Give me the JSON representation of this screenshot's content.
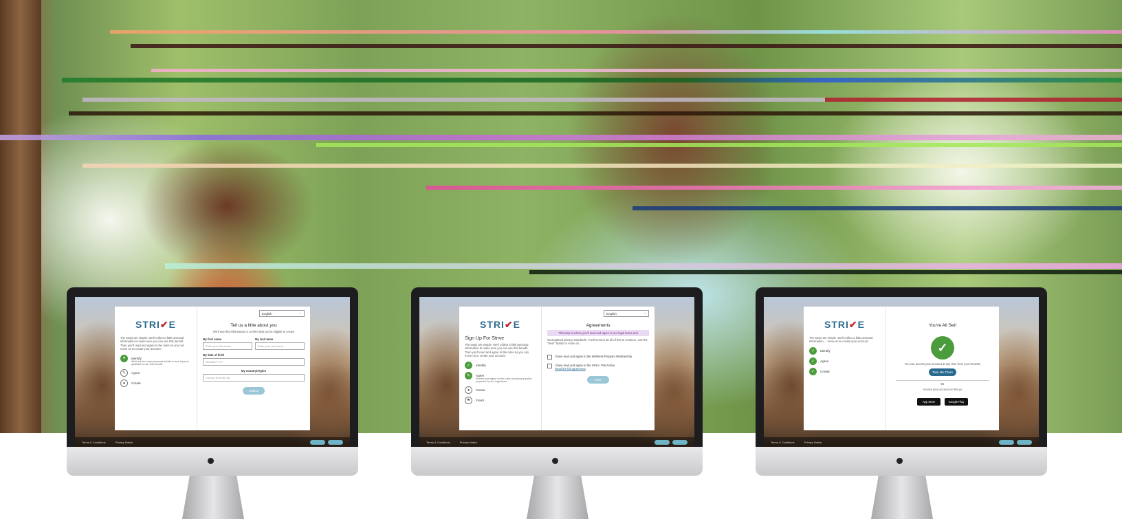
{
  "brand": {
    "logo_text_a": "STRI",
    "logo_tick": "✔",
    "logo_text_b": "E",
    "accent": "#2b6a8f",
    "check_green": "#4a9c3c"
  },
  "screens": [
    {
      "language": "English",
      "left": {
        "intro": "The steps are simple. We'll collect a little personal information to make sure you can use this benefit. Then you'll read and agree to the rules so you can move on to create your account.",
        "steps": [
          {
            "label": "Identify",
            "sub": "We'll ask for a few personal details to see if you're qualified to use this benefit."
          },
          {
            "label": "Agree",
            "sub": ""
          },
          {
            "label": "Create",
            "sub": ""
          }
        ]
      },
      "right": {
        "title": "Tell us a little about you",
        "text": "We'll use this information to confirm that you're eligible to create",
        "first_name_label": "My first name",
        "last_name_label": "My last name",
        "first_name_placeholder": "Enter your first name",
        "last_name_placeholder": "Enter your last name",
        "dob_label": "My date of birth",
        "dob_placeholder": "MM/DD/YYYY",
        "country_label": "My country/region",
        "country_placeholder": "Choose from the list",
        "submit": "Submit"
      },
      "footer": {
        "link1": "Terms & Conditions",
        "link2": "Privacy Notice"
      }
    },
    {
      "language": "English",
      "left": {
        "heading": "Sign Up For Strive",
        "intro": "The steps are simple. We'll collect a little personal information to make sure you can use this benefit. Then you'll read and agree to the rules so you can move on to create your account.",
        "steps": [
          {
            "label": "Identify",
            "sub": ""
          },
          {
            "label": "Agree",
            "sub": "Review and agree to the rules and privacy policy prepared by our legal team."
          },
          {
            "label": "Create",
            "sub": ""
          },
          {
            "label": "Finish",
            "sub": ""
          }
        ]
      },
      "right": {
        "title": "Agreements",
        "highlight": "This step is where you'll read and agree to our legal terms and",
        "text": "international privacy standards. You'll need to do all of this to continue. Use the \"Next\" button to move on.",
        "check1": "I have read and agree to the Wellness Program Membership",
        "check2": "I have read and agree to the GINA / PHI Notice",
        "check2_link": "Read the full agreement",
        "next": "Next"
      },
      "footer": {
        "link1": "Terms & Conditions",
        "link2": "Privacy Notice"
      }
    },
    {
      "left": {
        "intro": "The steps are simple. We'll collect a little personal information ... move on to create your account.",
        "steps": [
          {
            "label": "Identify",
            "sub": ""
          },
          {
            "label": "Agree",
            "sub": ""
          },
          {
            "label": "Create",
            "sub": ""
          }
        ]
      },
      "right": {
        "title": "You're All Set!",
        "text": "You can access your account at any time from your browser",
        "button": "Take Me There",
        "or": "Or",
        "app_text": "Access your account on the go",
        "app_store": "App Store",
        "google_play": "Google Play"
      },
      "footer": {
        "link1": "Terms & Conditions",
        "link2": "Privacy Notice"
      }
    }
  ]
}
